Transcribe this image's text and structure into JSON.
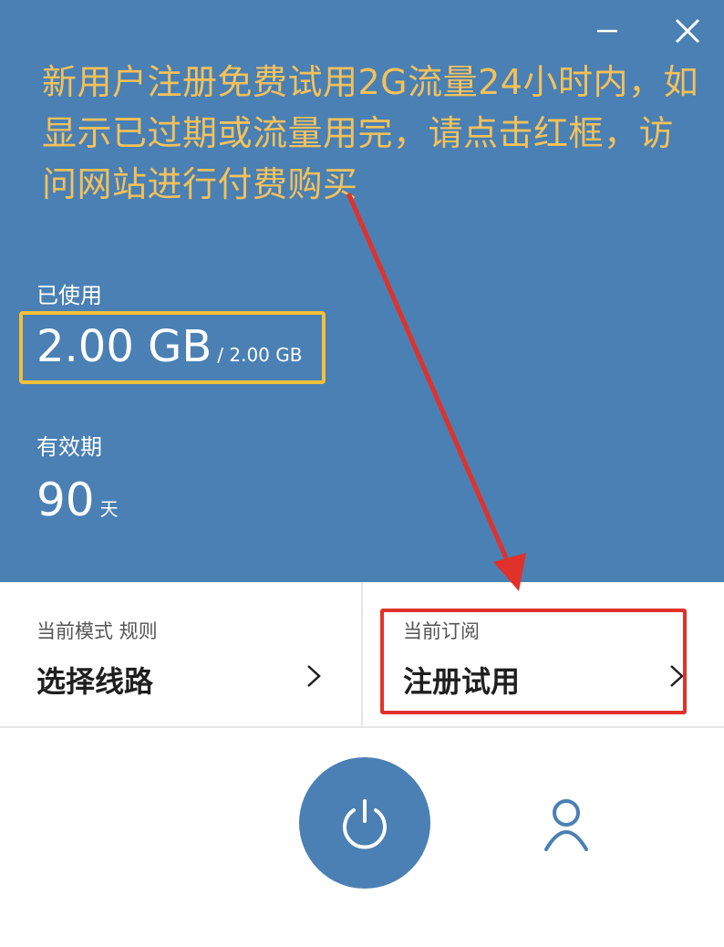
{
  "window": {
    "minimize_icon": "minimize-icon",
    "close_icon": "close-icon"
  },
  "notice": {
    "text": "新用户注册免费试用2G流量24小时内，如显示已过期或流量用完，请点击红框，访问网站进行付费购买",
    "color": "#f4c15a"
  },
  "usage": {
    "label": "已使用",
    "used": "2.00 GB",
    "total": "/ 2.00 GB"
  },
  "validity": {
    "label": "有效期",
    "days": "90",
    "unit": "天"
  },
  "mode": {
    "caption": "当前模式 规则",
    "title": "选择线路",
    "chevron_icon": "chevron-right-icon"
  },
  "subscription": {
    "caption": "当前订阅",
    "title": "注册试用",
    "chevron_icon": "chevron-right-icon"
  },
  "controls": {
    "power_icon": "power-icon",
    "user_icon": "user-icon"
  },
  "colors": {
    "panel_blue": "#4a80b4",
    "highlight_yellow": "#f2c037",
    "annotation_red": "#e0322a"
  }
}
